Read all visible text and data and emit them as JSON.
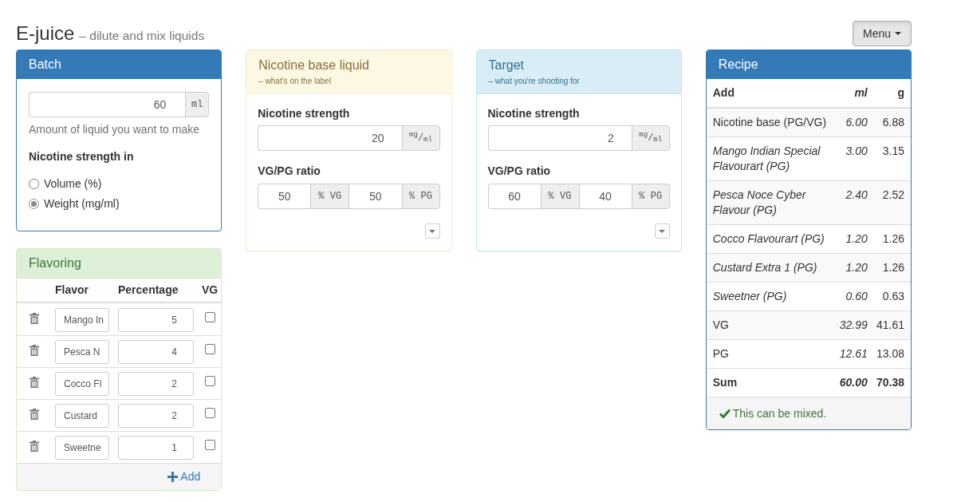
{
  "header": {
    "title": "E-juice",
    "subtitle": "– dilute and mix liquids",
    "menu_button": "Menu"
  },
  "batch": {
    "title": "Batch",
    "amount": {
      "value": "60",
      "unit": "ml"
    },
    "help": "Amount of liquid you want to make",
    "strength_label": "Nicotine strength in",
    "options": [
      {
        "label": "Volume (%)",
        "selected": false
      },
      {
        "label": "Weight (mg/ml)",
        "selected": true
      }
    ]
  },
  "flavoring": {
    "title": "Flavoring",
    "columns": [
      "Flavor",
      "Percentage",
      "VG"
    ],
    "rows": [
      {
        "flavor": "Mango In",
        "percentage": "5",
        "vg": false
      },
      {
        "flavor": "Pesca N",
        "percentage": "4",
        "vg": false
      },
      {
        "flavor": "Cocco Fl",
        "percentage": "2",
        "vg": false
      },
      {
        "flavor": "Custard",
        "percentage": "2",
        "vg": false
      },
      {
        "flavor": "Sweetne",
        "percentage": "1",
        "vg": false
      }
    ],
    "add_link": "Add"
  },
  "nicotine_base": {
    "title": "Nicotine base liquid",
    "subtitle": "– what's on the label",
    "strength_label": "Nicotine strength",
    "strength": {
      "value": "20",
      "unit": "$^{mg}$/$_{ml}$"
    },
    "ratio_label": "VG/PG ratio",
    "vg": {
      "value": "50",
      "unit": "% VG"
    },
    "pg": {
      "value": "50",
      "unit": "% PG"
    }
  },
  "target": {
    "title": "Target",
    "subtitle": "– what you're shooting for",
    "strength_label": "Nicotine strength",
    "strength": {
      "value": "2",
      "unit": "$^{mg}$/$_{ml}$"
    },
    "ratio_label": "VG/PG ratio",
    "vg": {
      "value": "60",
      "unit": "% VG"
    },
    "pg": {
      "value": "40",
      "unit": "% PG"
    }
  },
  "recipe": {
    "title": "Recipe",
    "columns": [
      "Add",
      "ml",
      "g"
    ],
    "rows": [
      {
        "kind": "base",
        "name": "Nicotine base (PG/VG)",
        "ml": "6.00",
        "g": "6.88"
      },
      {
        "kind": "flavor",
        "name": "Mango Indian Special Flavourart (PG)",
        "ml": "3.00",
        "g": "3.15"
      },
      {
        "kind": "flavor",
        "name": "Pesca Noce Cyber Flavour (PG)",
        "ml": "2.40",
        "g": "2.52"
      },
      {
        "kind": "flavor",
        "name": "Cocco Flavourart (PG)",
        "ml": "1.20",
        "g": "1.26"
      },
      {
        "kind": "flavor",
        "name": "Custard Extra 1 (PG)",
        "ml": "1.20",
        "g": "1.26"
      },
      {
        "kind": "flavor",
        "name": "Sweetner (PG)",
        "ml": "0.60",
        "g": "0.63"
      },
      {
        "kind": "component",
        "name": "VG",
        "ml": "32.99",
        "g": "41.61"
      },
      {
        "kind": "component",
        "name": "PG",
        "ml": "12.61",
        "g": "13.08"
      },
      {
        "kind": "total",
        "name": "Sum",
        "ml": "60.00",
        "g": "70.38"
      }
    ],
    "status": "This can be mixed."
  }
}
